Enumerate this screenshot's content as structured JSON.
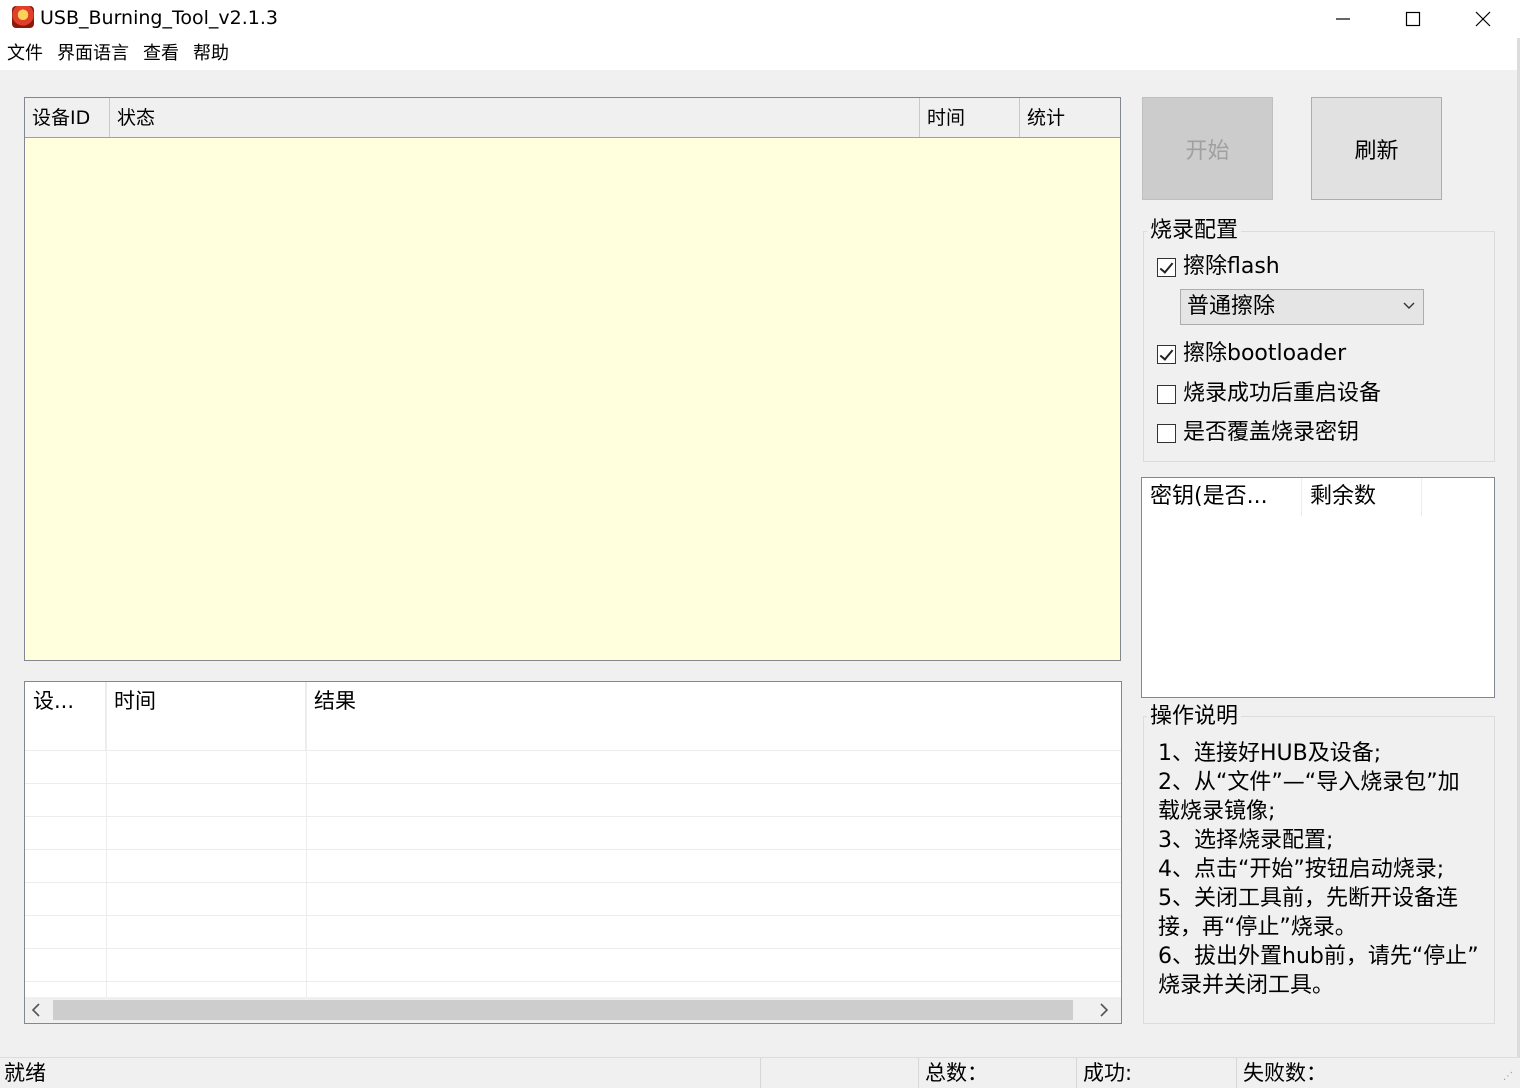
{
  "window": {
    "title": "USB_Burning_Tool_v2.1.3"
  },
  "menu": {
    "items": [
      "文件",
      "界面语言",
      "查看",
      "帮助"
    ]
  },
  "device_list": {
    "columns": [
      "设备ID",
      "状态",
      "时间",
      "统计"
    ],
    "background": "#ffffdd"
  },
  "log_list": {
    "columns": [
      "设...",
      "时间",
      "结果"
    ]
  },
  "buttons": {
    "start": "开始",
    "refresh": "刷新"
  },
  "burn_config": {
    "title": "烧录配置",
    "erase_flash": {
      "label": "擦除flash",
      "checked": true
    },
    "erase_mode": {
      "value": "普通擦除"
    },
    "erase_bootloader": {
      "label": "擦除bootloader",
      "checked": true
    },
    "reboot_after": {
      "label": "烧录成功后重启设备",
      "checked": false
    },
    "overwrite_key": {
      "label": "是否覆盖烧录密钥",
      "checked": false
    }
  },
  "key_list": {
    "columns": [
      "密钥(是否...",
      "剩余数"
    ]
  },
  "instructions": {
    "title": "操作说明",
    "lines": [
      "1、连接好HUB及设备;",
      "2、从“文件”—“导入烧录包”加",
      "载烧录镜像;",
      "3、选择烧录配置;",
      "4、点击“开始”按钮启动烧录;",
      "5、关闭工具前，先断开设备连",
      "接，再“停止”烧录。",
      "6、拔出外置hub前，请先“停止”",
      "烧录并关闭工具。"
    ]
  },
  "status": {
    "ready": "就绪",
    "total": "总数：",
    "success": "成功:",
    "fail": "失败数："
  },
  "icons": {
    "app": "app-icon",
    "minimize": "minimize-icon",
    "maximize": "maximize-icon",
    "close": "close-icon",
    "dropdown": "chevron-down-icon",
    "scroll_left": "chevron-left-icon",
    "scroll_right": "chevron-right-icon"
  }
}
